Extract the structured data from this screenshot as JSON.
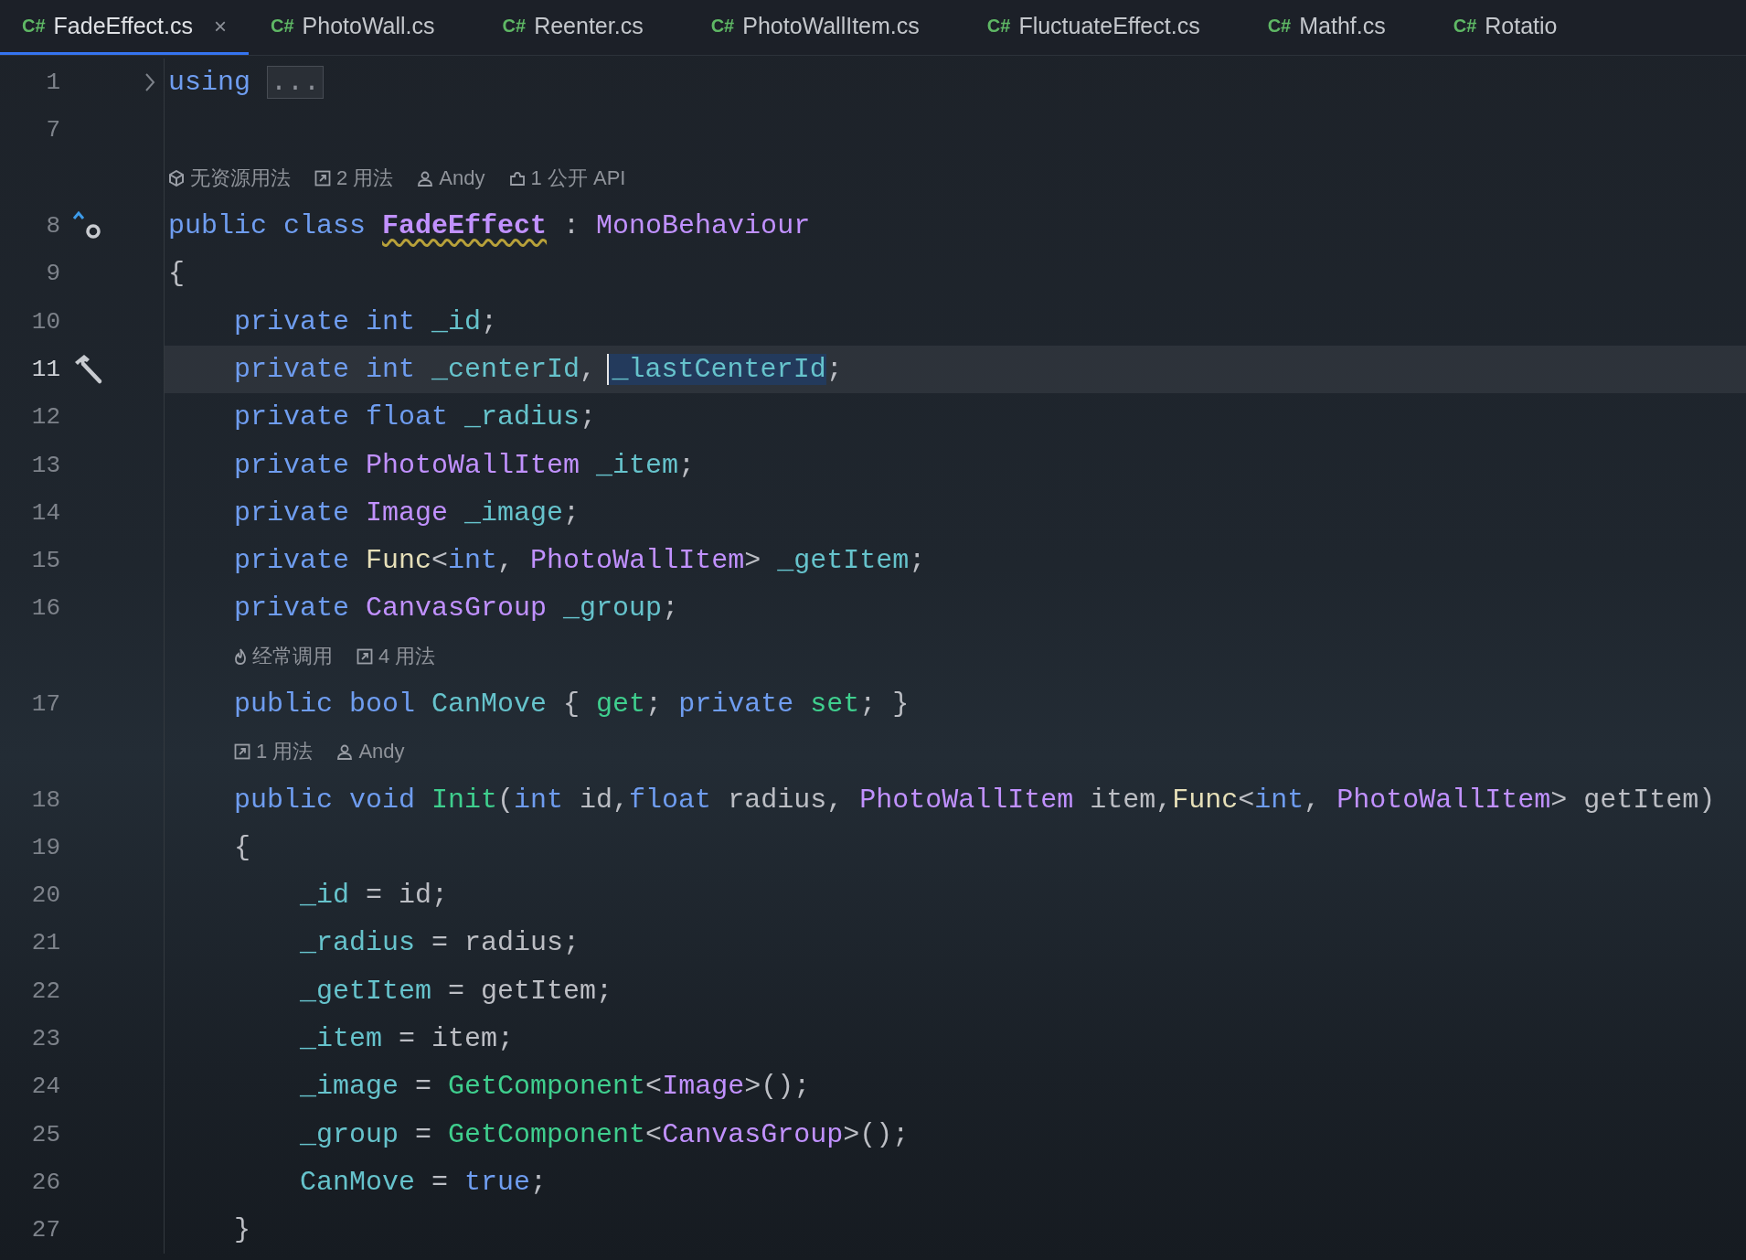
{
  "tabs": [
    {
      "lang": "C#",
      "label": "FadeEffect.cs",
      "selected": true,
      "close": "×"
    },
    {
      "lang": "C#",
      "label": "PhotoWall.cs",
      "selected": false
    },
    {
      "lang": "C#",
      "label": "Reenter.cs",
      "selected": false
    },
    {
      "lang": "C#",
      "label": "PhotoWallItem.cs",
      "selected": false
    },
    {
      "lang": "C#",
      "label": "FluctuateEffect.cs",
      "selected": false
    },
    {
      "lang": "C#",
      "label": "Mathf.cs",
      "selected": false
    },
    {
      "lang": "C#",
      "label": "Rotatio",
      "selected": false
    }
  ],
  "lines": [
    {
      "kind": "code",
      "number": "1",
      "current": false,
      "marker": {
        "kind": "fold"
      },
      "tokens": [
        {
          "text": "using ",
          "kind": "keyword"
        },
        {
          "text": "...",
          "kind": "folded"
        }
      ]
    },
    {
      "kind": "code",
      "number": "7",
      "current": false
    },
    {
      "kind": "hints",
      "hints": [
        {
          "kind": "unity",
          "text": "无资源用法"
        },
        {
          "kind": "usages",
          "text": "2 用法"
        },
        {
          "kind": "user",
          "text": "Andy"
        },
        {
          "kind": "api",
          "text": "1 公开 API"
        }
      ]
    },
    {
      "kind": "code",
      "number": "8",
      "current": false,
      "marker": {
        "kind": "implements"
      },
      "tokens": [
        {
          "text": "public class ",
          "kind": "keyword"
        },
        {
          "text": "FadeEffect",
          "kind": "warning-type"
        },
        {
          "text": " : ",
          "kind": "plain"
        },
        {
          "text": "MonoBehaviour",
          "kind": "type"
        }
      ]
    },
    {
      "kind": "code",
      "number": "9",
      "current": false,
      "tokens": [
        {
          "text": "{",
          "kind": "plain"
        }
      ]
    },
    {
      "kind": "code",
      "number": "10",
      "current": false,
      "tokens": [
        {
          "text": "    private int ",
          "kind": "keyword"
        },
        {
          "text": "_id",
          "kind": "field"
        },
        {
          "text": ";",
          "kind": "plain"
        }
      ]
    },
    {
      "kind": "code",
      "number": "11",
      "current": true,
      "marker": {
        "kind": "hammer"
      },
      "tokens": [
        {
          "text": "    private int ",
          "kind": "keyword"
        },
        {
          "text": "_centerId",
          "kind": "field"
        },
        {
          "text": ", ",
          "kind": "plain"
        },
        {
          "text": "_lastCenterId",
          "kind": "selection"
        },
        {
          "text": ";",
          "kind": "plain"
        }
      ]
    },
    {
      "kind": "code",
      "number": "12",
      "current": false,
      "tokens": [
        {
          "text": "    private float ",
          "kind": "keyword"
        },
        {
          "text": "_radius",
          "kind": "field"
        },
        {
          "text": ";",
          "kind": "plain"
        }
      ]
    },
    {
      "kind": "code",
      "number": "13",
      "current": false,
      "tokens": [
        {
          "text": "    private ",
          "kind": "keyword"
        },
        {
          "text": "PhotoWallItem ",
          "kind": "type"
        },
        {
          "text": "_item",
          "kind": "field"
        },
        {
          "text": ";",
          "kind": "plain"
        }
      ]
    },
    {
      "kind": "code",
      "number": "14",
      "current": false,
      "tokens": [
        {
          "text": "    private ",
          "kind": "keyword"
        },
        {
          "text": "Image ",
          "kind": "type"
        },
        {
          "text": "_image",
          "kind": "field"
        },
        {
          "text": ";",
          "kind": "plain"
        }
      ]
    },
    {
      "kind": "code",
      "number": "15",
      "current": false,
      "tokens": [
        {
          "text": "    private ",
          "kind": "keyword"
        },
        {
          "text": "Func",
          "kind": "delegate"
        },
        {
          "text": "<",
          "kind": "plain"
        },
        {
          "text": "int",
          "kind": "keyword"
        },
        {
          "text": ", ",
          "kind": "plain"
        },
        {
          "text": "PhotoWallItem",
          "kind": "type"
        },
        {
          "text": "> ",
          "kind": "plain"
        },
        {
          "text": "_getItem",
          "kind": "field"
        },
        {
          "text": ";",
          "kind": "plain"
        }
      ]
    },
    {
      "kind": "code",
      "number": "16",
      "current": false,
      "tokens": [
        {
          "text": "    private ",
          "kind": "keyword"
        },
        {
          "text": "CanvasGroup ",
          "kind": "type"
        },
        {
          "text": "_group",
          "kind": "field"
        },
        {
          "text": ";",
          "kind": "plain"
        }
      ]
    },
    {
      "kind": "hints",
      "hints": [
        {
          "kind": "flame",
          "text": "经常调用"
        },
        {
          "kind": "usages",
          "text": "4 用法"
        }
      ]
    },
    {
      "kind": "code",
      "number": "17",
      "current": false,
      "tokens": [
        {
          "text": "    public bool ",
          "kind": "keyword"
        },
        {
          "text": "CanMove",
          "kind": "field"
        },
        {
          "text": " { ",
          "kind": "plain"
        },
        {
          "text": "get",
          "kind": "method"
        },
        {
          "text": "; ",
          "kind": "plain"
        },
        {
          "text": "private ",
          "kind": "keyword"
        },
        {
          "text": "set",
          "kind": "method"
        },
        {
          "text": "; }",
          "kind": "plain"
        }
      ]
    },
    {
      "kind": "hints",
      "hints": [
        {
          "kind": "usages",
          "text": "1 用法"
        },
        {
          "kind": "user",
          "text": "Andy"
        }
      ]
    },
    {
      "kind": "code",
      "number": "18",
      "current": false,
      "tokens": [
        {
          "text": "    public void ",
          "kind": "keyword"
        },
        {
          "text": "Init",
          "kind": "method"
        },
        {
          "text": "(",
          "kind": "plain"
        },
        {
          "text": "int",
          "kind": "keyword"
        },
        {
          "text": " id,",
          "kind": "plain"
        },
        {
          "text": "float",
          "kind": "keyword"
        },
        {
          "text": " radius, ",
          "kind": "plain"
        },
        {
          "text": "PhotoWallItem",
          "kind": "type"
        },
        {
          "text": " item,",
          "kind": "plain"
        },
        {
          "text": "Func",
          "kind": "delegate"
        },
        {
          "text": "<",
          "kind": "plain"
        },
        {
          "text": "int",
          "kind": "keyword"
        },
        {
          "text": ", ",
          "kind": "plain"
        },
        {
          "text": "PhotoWallItem",
          "kind": "type"
        },
        {
          "text": "> getItem)",
          "kind": "plain"
        }
      ]
    },
    {
      "kind": "code",
      "number": "19",
      "current": false,
      "tokens": [
        {
          "text": "    {",
          "kind": "plain"
        }
      ]
    },
    {
      "kind": "code",
      "number": "20",
      "current": false,
      "tokens": [
        {
          "text": "        _id",
          "kind": "field"
        },
        {
          "text": " = id;",
          "kind": "plain"
        }
      ]
    },
    {
      "kind": "code",
      "number": "21",
      "current": false,
      "tokens": [
        {
          "text": "        _radius",
          "kind": "field"
        },
        {
          "text": " = radius;",
          "kind": "plain"
        }
      ]
    },
    {
      "kind": "code",
      "number": "22",
      "current": false,
      "tokens": [
        {
          "text": "        _getItem",
          "kind": "field"
        },
        {
          "text": " = getItem;",
          "kind": "plain"
        }
      ]
    },
    {
      "kind": "code",
      "number": "23",
      "current": false,
      "tokens": [
        {
          "text": "        _item",
          "kind": "field"
        },
        {
          "text": " = item;",
          "kind": "plain"
        }
      ]
    },
    {
      "kind": "code",
      "number": "24",
      "current": false,
      "tokens": [
        {
          "text": "        _image",
          "kind": "field"
        },
        {
          "text": " = ",
          "kind": "plain"
        },
        {
          "text": "GetComponent",
          "kind": "method"
        },
        {
          "text": "<",
          "kind": "plain"
        },
        {
          "text": "Image",
          "kind": "type"
        },
        {
          "text": ">();",
          "kind": "plain"
        }
      ]
    },
    {
      "kind": "code",
      "number": "25",
      "current": false,
      "tokens": [
        {
          "text": "        _group",
          "kind": "field"
        },
        {
          "text": " = ",
          "kind": "plain"
        },
        {
          "text": "GetComponent",
          "kind": "method"
        },
        {
          "text": "<",
          "kind": "plain"
        },
        {
          "text": "CanvasGroup",
          "kind": "type"
        },
        {
          "text": ">();",
          "kind": "plain"
        }
      ]
    },
    {
      "kind": "code",
      "number": "26",
      "current": false,
      "tokens": [
        {
          "text": "        CanMove",
          "kind": "field"
        },
        {
          "text": " = ",
          "kind": "plain"
        },
        {
          "text": "true",
          "kind": "keyword"
        },
        {
          "text": ";",
          "kind": "plain"
        }
      ]
    },
    {
      "kind": "code",
      "number": "27",
      "current": false,
      "tokens": [
        {
          "text": "    }",
          "kind": "plain"
        }
      ]
    }
  ]
}
